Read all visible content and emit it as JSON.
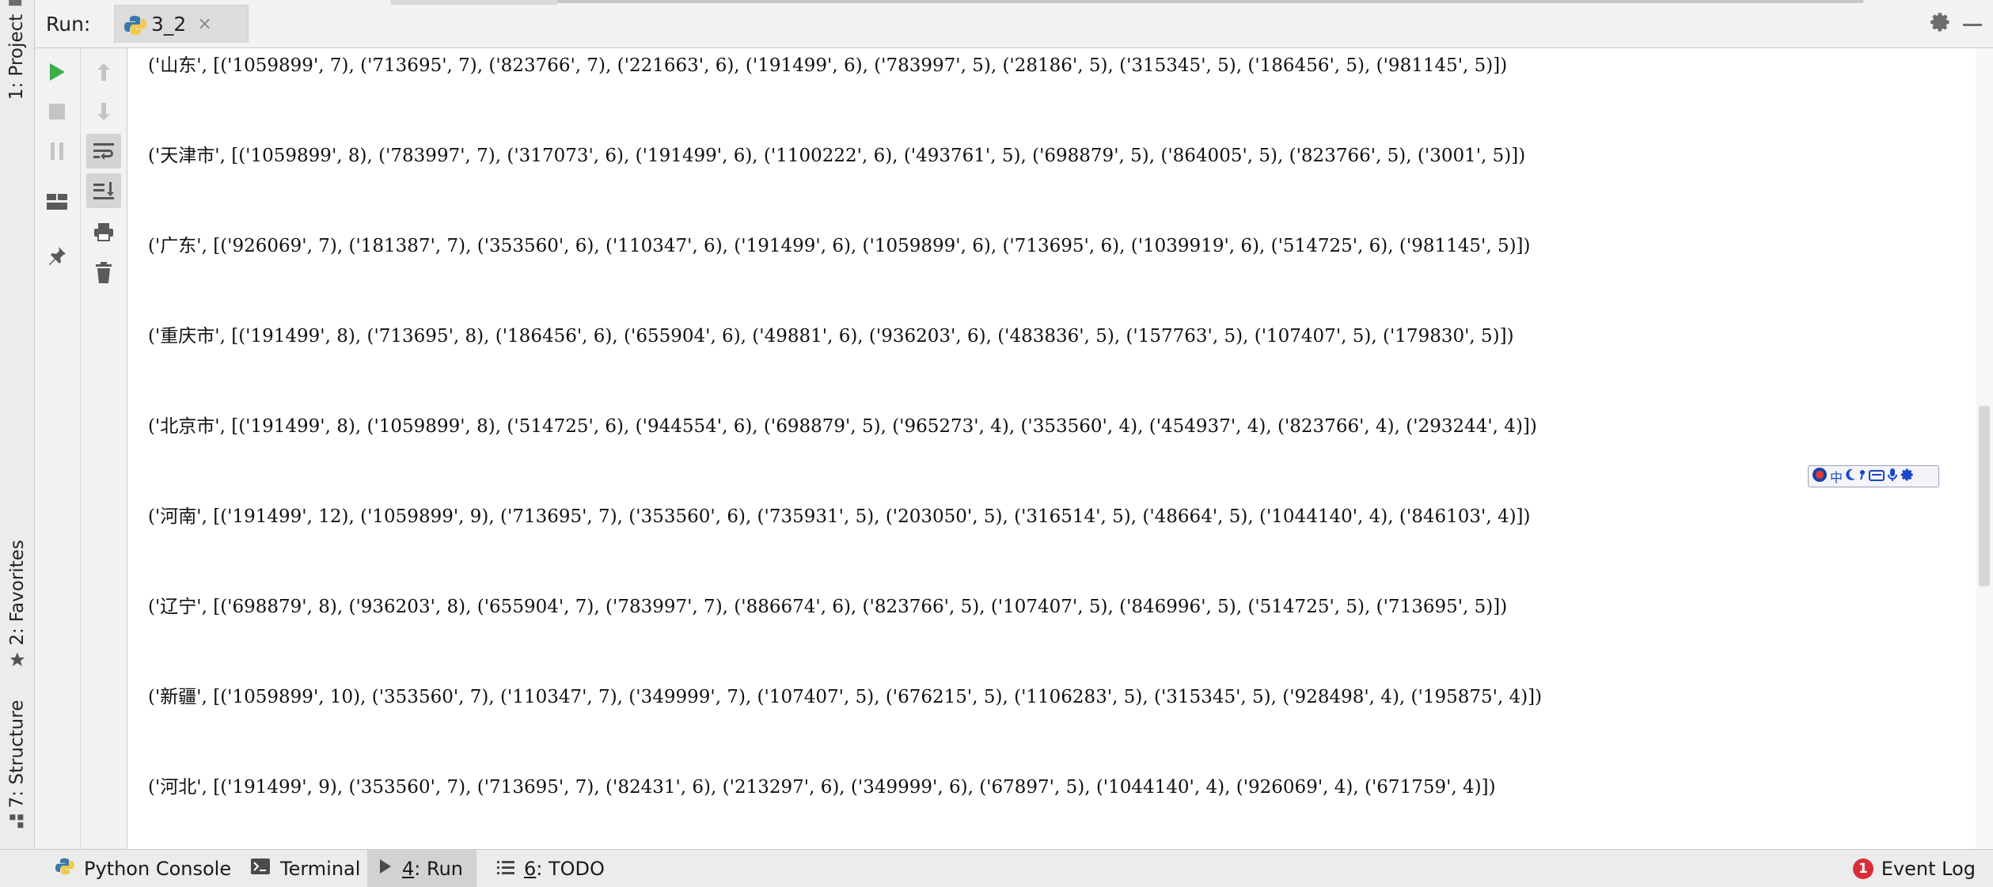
{
  "left_strip": {
    "project_tab": "1: Project",
    "favorites_tab": "2: Favorites",
    "structure_tab": "7: Structure"
  },
  "run_header": {
    "label": "Run:",
    "tab_label": "3_2",
    "tab_close": "×"
  },
  "console": {
    "lines": [
      "('山东', [('1059899', 7), ('713695', 7), ('823766', 7), ('221663', 6), ('191499', 6), ('783997', 5), ('28186', 5), ('315345', 5), ('186456', 5), ('981145', 5)])",
      "('天津市', [('1059899', 8), ('783997', 7), ('317073', 6), ('191499', 6), ('1100222', 6), ('493761', 5), ('698879', 5), ('864005', 5), ('823766', 5), ('3001', 5)])",
      "('广东', [('926069', 7), ('181387', 7), ('353560', 6), ('110347', 6), ('191499', 6), ('1059899', 6), ('713695', 6), ('1039919', 6), ('514725', 6), ('981145', 5)])",
      "('重庆市', [('191499', 8), ('713695', 8), ('186456', 6), ('655904', 6), ('49881', 6), ('936203', 6), ('483836', 5), ('157763', 5), ('107407', 5), ('179830', 5)])",
      "('北京市', [('191499', 8), ('1059899', 8), ('514725', 6), ('944554', 6), ('698879', 5), ('965273', 4), ('353560', 4), ('454937', 4), ('823766', 4), ('293244', 4)])",
      "('河南', [('191499', 12), ('1059899', 9), ('713695', 7), ('353560', 6), ('735931', 5), ('203050', 5), ('316514', 5), ('48664', 5), ('1044140', 4), ('846103', 4)])",
      "('辽宁', [('698879', 8), ('936203', 8), ('655904', 7), ('783997', 7), ('886674', 6), ('823766', 5), ('107407', 5), ('846996', 5), ('514725', 5), ('713695', 5)])",
      "('新疆', [('1059899', 10), ('353560', 7), ('110347', 7), ('349999', 7), ('107407', 5), ('676215', 5), ('1106283', 5), ('315345', 5), ('928498', 4), ('195875', 4)])",
      "('河北', [('191499', 9), ('353560', 7), ('713695', 7), ('82431', 6), ('213297', 6), ('349999', 6), ('67897', 5), ('1044140', 4), ('926069', 4), ('671759', 4)])"
    ]
  },
  "ime_toolbar": {
    "chinese_char": "中"
  },
  "bottom_bar": {
    "python_console": "Python Console",
    "terminal": "Terminal",
    "run_num": "4",
    "run_label": ": Run",
    "todo_num": "6",
    "todo_label": ": TODO",
    "event_log": "Event Log",
    "event_count": "1"
  },
  "colors": {
    "run_green": "#3cad47",
    "badge_red": "#d92d3a",
    "ime_blue": "#1746c8"
  }
}
